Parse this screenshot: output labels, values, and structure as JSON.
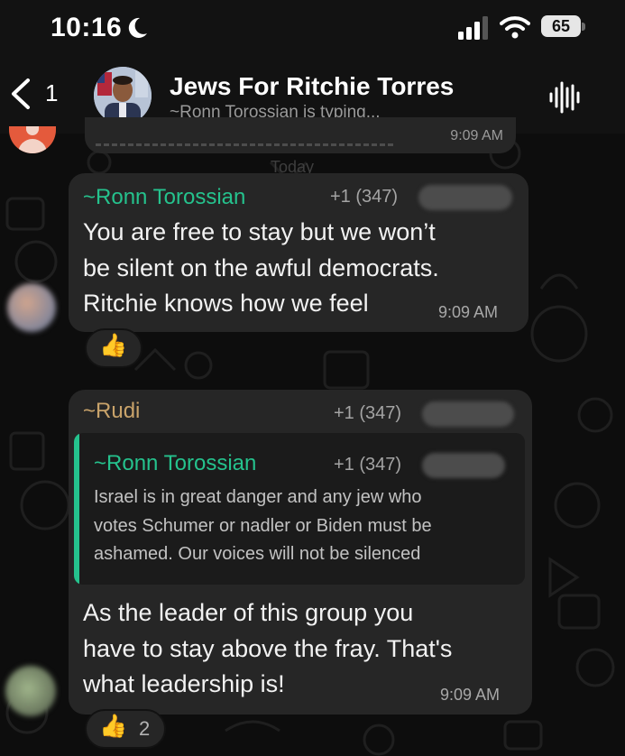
{
  "status_bar": {
    "time": "10:16",
    "battery": "65",
    "icons": [
      "moon-icon",
      "cellular-signal-icon",
      "wifi-icon",
      "battery-icon"
    ]
  },
  "header": {
    "back_count": "1",
    "title": "Jews For Ritchie Torres",
    "status": "~Ronn Torossian is typing...",
    "icons": [
      "chevron-left-icon",
      "voice-chat-icon"
    ]
  },
  "chat": {
    "partial_message": {
      "time": "9:09 AM"
    },
    "date_divider": "Today",
    "messages": [
      {
        "sender": "~Ronn Torossian",
        "phone": "+1 (347)",
        "lines": [
          "You are free to stay but we won’t",
          "be silent on the awful democrats.",
          "Ritchie knows how we feel"
        ],
        "time": "9:09 AM",
        "reaction": {
          "emoji": "👍",
          "count": ""
        }
      },
      {
        "sender": "~Rudi",
        "phone": "+1 (347)",
        "quote": {
          "sender": "~Ronn Torossian",
          "phone": "+1 (347)",
          "lines": [
            "Israel is in great danger and any jew who",
            "votes Schumer or nadler or Biden must be",
            "ashamed. Our voices will not be silenced"
          ]
        },
        "lines": [
          "As the leader of this group you",
          "have to stay above the fray. That's",
          "what leadership is!"
        ],
        "time": "9:09 AM",
        "reaction": {
          "emoji": "👍",
          "count": "2"
        }
      }
    ]
  },
  "colors": {
    "background": "#0d0d0d",
    "bubble": "#262626",
    "sender_green": "#25c28d",
    "sender_tan": "#c9a36a"
  }
}
